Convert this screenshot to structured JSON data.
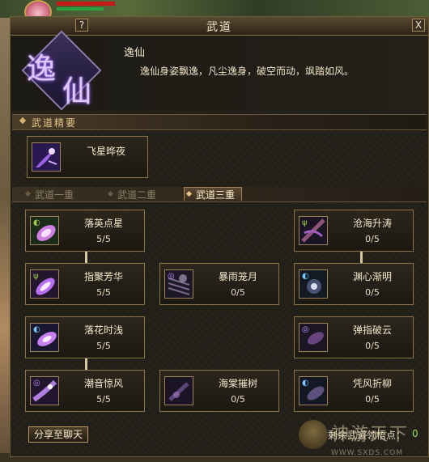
{
  "window": {
    "title": "武道",
    "help_label": "?",
    "close_label": "X"
  },
  "header": {
    "emblem_chars": [
      "逸",
      "仙"
    ],
    "name": "逸仙",
    "description": "逸仙身姿飘逸，凡尘逸身，破空而动，飒踏如风。"
  },
  "essence": {
    "section_title": "武道精要",
    "skill": {
      "name": "飞星晔夜"
    }
  },
  "tabs": [
    {
      "label": "武道一重",
      "active": false
    },
    {
      "label": "武道二重",
      "active": false
    },
    {
      "label": "武道三重",
      "active": true
    }
  ],
  "skills": [
    {
      "name": "落英点星",
      "level": "5/5"
    },
    {
      "name": "沧海升涛",
      "level": "0/5"
    },
    {
      "name": "指聚芳华",
      "level": "5/5"
    },
    {
      "name": "暴雨笼月",
      "level": "0/5"
    },
    {
      "name": "渊心渐明",
      "level": "0/5"
    },
    {
      "name": "落花时浅",
      "level": "5/5"
    },
    {
      "name": "弹指破云",
      "level": "0/5"
    },
    {
      "name": "潮音惊风",
      "level": "5/5"
    },
    {
      "name": "海棠摧树",
      "level": "0/5"
    },
    {
      "name": "凭风折柳",
      "level": "0/5"
    }
  ],
  "footer": {
    "share_label": "分享至聊天",
    "points_label": "剩余武道领悟点：",
    "points_value": "0"
  },
  "watermark": {
    "text": "神游天下",
    "url": "WWW.SXDS.COM"
  },
  "colors": {
    "accent_gold": "#d4b070",
    "panel_bg": "#232019",
    "border": "#8a7448",
    "points_green": "#9fe060"
  },
  "icons": {
    "essence": "star-comet-icon",
    "skill_learned": "purple-petal-icon",
    "skill_locked": "purple-mist-icon"
  }
}
